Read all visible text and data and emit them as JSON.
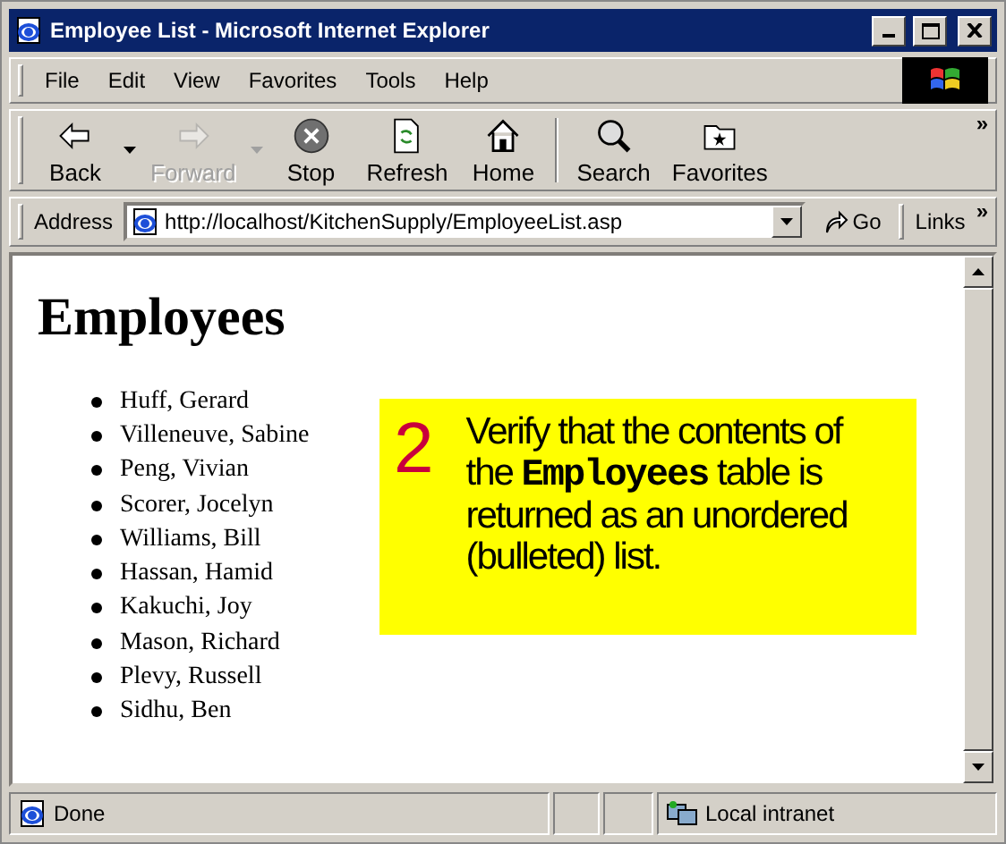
{
  "window": {
    "title": "Employee List - Microsoft Internet Explorer"
  },
  "menu": [
    "File",
    "Edit",
    "View",
    "Favorites",
    "Tools",
    "Help"
  ],
  "toolbar": [
    {
      "label": "Back",
      "disabled": false,
      "dropdown": true
    },
    {
      "label": "Forward",
      "disabled": true,
      "dropdown": true
    },
    {
      "label": "Stop",
      "disabled": false
    },
    {
      "label": "Refresh",
      "disabled": false
    },
    {
      "label": "Home",
      "disabled": false
    },
    {
      "label": "Search",
      "disabled": false,
      "separator_before": true
    },
    {
      "label": "Favorites",
      "disabled": false
    }
  ],
  "toolbar_more": "»",
  "address": {
    "label": "Address",
    "value": "http://localhost/KitchenSupply/EmployeeList.asp",
    "go": "Go",
    "links": "Links",
    "links_more": "»"
  },
  "page": {
    "heading": "Employees",
    "items": [
      "Huff, Gerard",
      "Villeneuve, Sabine",
      "Peng, Vivian",
      "Scorer, Jocelyn",
      "Williams, Bill",
      "Hassan, Hamid",
      "Kakuchi, Joy",
      "Mason, Richard",
      "Plevy, Russell",
      "Sidhu, Ben"
    ]
  },
  "callout": {
    "number": "2",
    "text": "Verify that the contents of the **Employees** table is returned as an unordered (bulleted) list."
  },
  "status_bar": {
    "text": "Done",
    "zone": "Local intranet"
  }
}
